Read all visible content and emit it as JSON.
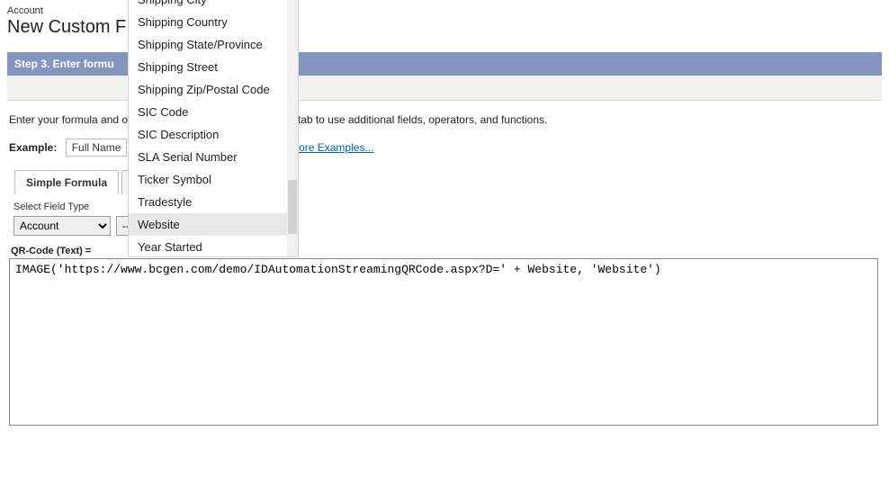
{
  "header": {
    "object_label": "Account",
    "page_title": "New Custom F"
  },
  "step_bar": {
    "label": "Step 3. Enter formu"
  },
  "instructions": "Enter your formula and                                                  ors. Click the Advanced Formula subtab to use additional fields, operators, and functions.",
  "example": {
    "label": "Example:",
    "value": "Full Name",
    "more_link": "ore Examples..."
  },
  "tabs": {
    "simple": "Simple Formula",
    "advanced": "A"
  },
  "field_type": {
    "label": "Select Field Type",
    "select_value": "Account",
    "merge_placeholder": "-- Insert Merge Field --"
  },
  "dropdown_items": [
    "Shipping City",
    "Shipping Country",
    "Shipping State/Province",
    "Shipping Street",
    "Shipping Zip/Postal Code",
    "SIC Code",
    "SIC Description",
    "SLA Serial Number",
    "Ticker Symbol",
    "Tradestyle",
    "Website",
    "Year Started"
  ],
  "dropdown_highlight": "Website",
  "formula": {
    "label": "QR-Code (Text) =",
    "value": "IMAGE('https://www.bcgen.com/demo/IDAutomationStreamingQRCode.aspx?D=' + Website, 'Website')"
  }
}
